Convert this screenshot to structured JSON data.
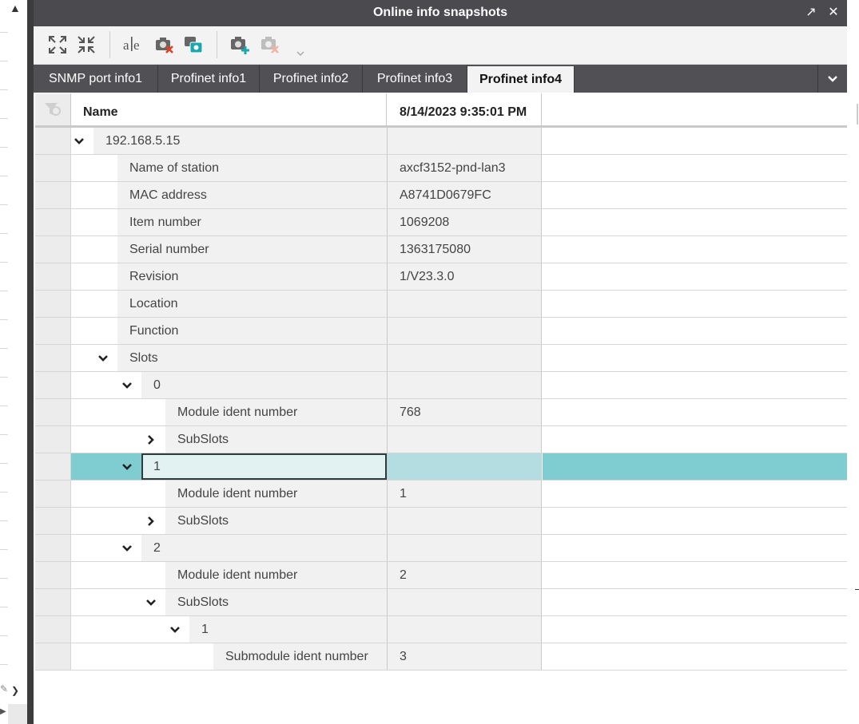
{
  "window": {
    "title": "Online info snapshots",
    "buttons": {
      "float_icon": "↗",
      "close_icon": "✕"
    }
  },
  "toolbar": {
    "tools": [
      {
        "name": "expand-all-icon"
      },
      {
        "name": "collapse-all-icon"
      },
      {
        "name": "rename-icon"
      },
      {
        "name": "delete-snapshot-icon"
      },
      {
        "name": "copy-snapshot-icon"
      },
      {
        "name": "take-snapshot-icon"
      },
      {
        "name": "remove-snapshot-icon"
      }
    ]
  },
  "tabs": [
    {
      "label": "SNMP port info1",
      "active": false
    },
    {
      "label": "Profinet info1",
      "active": false
    },
    {
      "label": "Profinet info2",
      "active": false
    },
    {
      "label": "Profinet info3",
      "active": false
    },
    {
      "label": "Profinet info4",
      "active": true
    }
  ],
  "grid": {
    "headers": {
      "name": "Name",
      "snapshot": "8/14/2023 9:35:01 PM"
    },
    "rows": [
      {
        "name": "192.168.5.15",
        "value": "",
        "level": 0,
        "toggle": "expanded",
        "selected": false
      },
      {
        "name": "Name of station",
        "value": "axcf3152-pnd-lan3",
        "level": 1,
        "toggle": "none",
        "selected": false
      },
      {
        "name": "MAC address",
        "value": "A8741D0679FC",
        "level": 1,
        "toggle": "none",
        "selected": false
      },
      {
        "name": "Item number",
        "value": "1069208",
        "level": 1,
        "toggle": "none",
        "selected": false
      },
      {
        "name": "Serial number",
        "value": "1363175080",
        "level": 1,
        "toggle": "none",
        "selected": false
      },
      {
        "name": "Revision",
        "value": "1/V23.3.0",
        "level": 1,
        "toggle": "none",
        "selected": false
      },
      {
        "name": "Location",
        "value": "",
        "level": 1,
        "toggle": "none",
        "selected": false
      },
      {
        "name": "Function",
        "value": "",
        "level": 1,
        "toggle": "none",
        "selected": false
      },
      {
        "name": "Slots",
        "value": "",
        "level": 1,
        "toggle": "expanded",
        "selected": false
      },
      {
        "name": "0",
        "value": "",
        "level": 2,
        "toggle": "expanded",
        "selected": false
      },
      {
        "name": "Module ident number",
        "value": "768",
        "level": 3,
        "toggle": "none",
        "selected": false
      },
      {
        "name": "SubSlots",
        "value": "",
        "level": 3,
        "toggle": "collapsed",
        "selected": false
      },
      {
        "name": "1",
        "value": "",
        "level": 2,
        "toggle": "expanded",
        "selected": true
      },
      {
        "name": "Module ident number",
        "value": "1",
        "level": 3,
        "toggle": "none",
        "selected": false
      },
      {
        "name": "SubSlots",
        "value": "",
        "level": 3,
        "toggle": "collapsed",
        "selected": false
      },
      {
        "name": "2",
        "value": "",
        "level": 2,
        "toggle": "expanded",
        "selected": false
      },
      {
        "name": "Module ident number",
        "value": "2",
        "level": 3,
        "toggle": "none",
        "selected": false
      },
      {
        "name": "SubSlots",
        "value": "",
        "level": 3,
        "toggle": "expanded",
        "selected": false
      },
      {
        "name": "1",
        "value": "",
        "level": 4,
        "toggle": "expanded",
        "selected": false
      },
      {
        "name": "Submodule ident number",
        "value": "3",
        "level": 5,
        "toggle": "none",
        "selected": false
      }
    ]
  },
  "colors": {
    "titlebar": "#4a4a4f",
    "tabbar": "#505055",
    "selection": "#7fcdd1",
    "selection_value": "#b3dde0"
  }
}
